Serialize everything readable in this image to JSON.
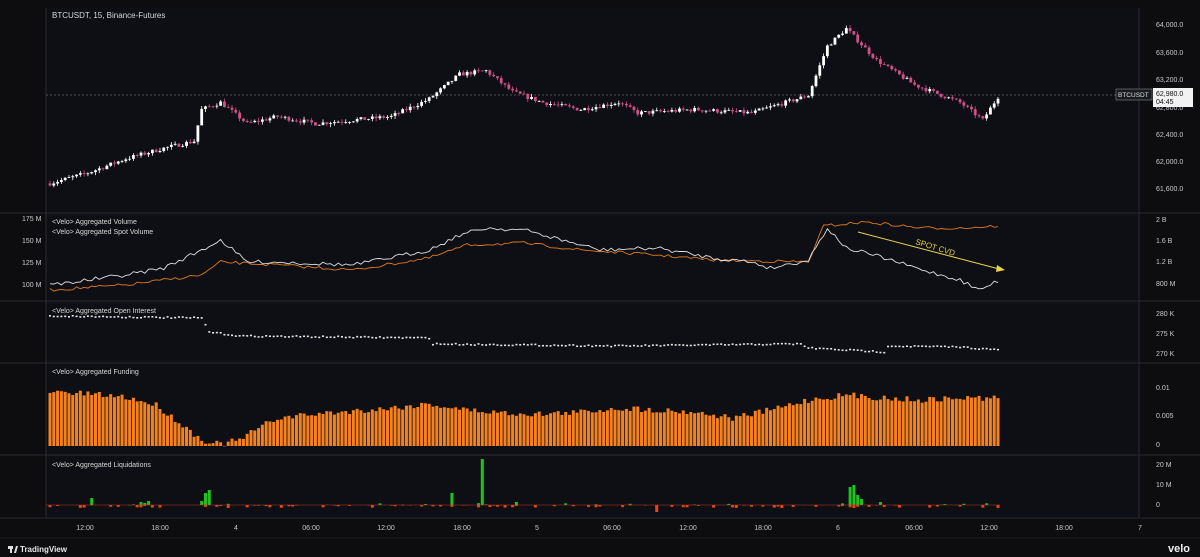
{
  "symbol_title": "BTCUSDT, 15, Binance-Futures",
  "price_badge": {
    "symbol": "BTCUSDT",
    "price": "62,980.0",
    "countdown": "04:45"
  },
  "colors": {
    "background": "#0d0d10",
    "candle_up": "#ffffff",
    "candle_down": "#d0508a",
    "spot_volume_line": "#e0e0e0",
    "aggregated_volume_line": "#e07a1e",
    "funding_bars": "#f5821f",
    "liq_long": "#1fc21f",
    "liq_short": "#e8451a",
    "annotation": "#e8d44a"
  },
  "price_axis": [
    "64,000.0",
    "63,600.0",
    "63,200.0",
    "62,800.0",
    "62,400.0",
    "62,000.0",
    "61,600.0"
  ],
  "panes": {
    "volume": {
      "label1": "<Velo> Aggregated Volume",
      "label2": "<Velo> Aggregated Spot Volume",
      "left_axis": [
        "175 M",
        "150 M",
        "125 M",
        "100 M"
      ],
      "right_axis": [
        "2 B",
        "1.6 B",
        "1.2 B",
        "800 M"
      ],
      "annotation": "SPOT CVD"
    },
    "open_interest": {
      "label": "<Velo> Aggregated Open Interest",
      "right_axis": [
        "280 K",
        "275 K",
        "270 K"
      ]
    },
    "funding": {
      "label": "<Velo> Aggregated Funding",
      "right_axis": [
        "0.01",
        "0.005",
        "0"
      ]
    },
    "liquidations": {
      "label": "<Velo> Aggregated Liquidations",
      "right_axis": [
        "20 M",
        "10 M",
        "0"
      ]
    }
  },
  "time_axis": [
    "12:00",
    "18:00",
    "4",
    "06:00",
    "12:00",
    "18:00",
    "5",
    "06:00",
    "12:00",
    "18:00",
    "6",
    "06:00",
    "12:00",
    "18:00",
    "7"
  ],
  "footer": {
    "left_brand": "TradingView",
    "right_brand": "velo"
  },
  "chart_data": {
    "type": "candlestick",
    "title": "BTCUSDT, 15, Binance-Futures",
    "ylim": [
      61400,
      64100
    ],
    "last_price": 62980,
    "price_key_points": [
      [
        0,
        61750
      ],
      [
        10,
        61900
      ],
      [
        20,
        62100
      ],
      [
        30,
        62250
      ],
      [
        38,
        62350
      ],
      [
        40,
        62800
      ],
      [
        45,
        62900
      ],
      [
        52,
        62600
      ],
      [
        60,
        62700
      ],
      [
        70,
        62600
      ],
      [
        80,
        62650
      ],
      [
        90,
        62700
      ],
      [
        100,
        62950
      ],
      [
        108,
        63300
      ],
      [
        115,
        63350
      ],
      [
        122,
        63050
      ],
      [
        130,
        62900
      ],
      [
        140,
        62800
      ],
      [
        150,
        62900
      ],
      [
        155,
        62750
      ],
      [
        170,
        62800
      ],
      [
        185,
        62750
      ],
      [
        200,
        63000
      ],
      [
        205,
        63700
      ],
      [
        210,
        63950
      ],
      [
        218,
        63500
      ],
      [
        228,
        63150
      ],
      [
        240,
        62900
      ],
      [
        246,
        62650
      ],
      [
        250,
        62980
      ]
    ],
    "funding_range": [
      0,
      0.0125
    ],
    "open_interest_range": [
      268000,
      282000
    ],
    "liquidations_range_millions": [
      -3,
      22
    ]
  }
}
